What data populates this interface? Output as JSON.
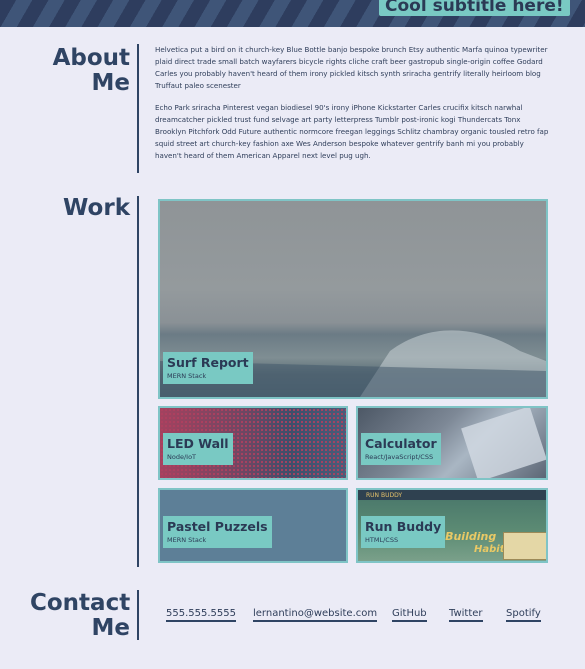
{
  "header": {
    "subtitle": "Cool subtitle here!"
  },
  "about": {
    "title_line1": "About",
    "title_line2": "Me",
    "paragraphs": [
      "Helvetica put a bird on it church-key Blue Bottle banjo bespoke brunch Etsy authentic Marfa quinoa typewriter plaid direct trade small batch wayfarers bicycle rights cliche craft beer gastropub single-origin coffee Godard Carles you probably haven't heard of them irony pickled kitsch synth sriracha gentrify literally heirloom blog Truffaut paleo scenester",
      "Echo Park sriracha Pinterest vegan biodiesel 90's irony iPhone Kickstarter Carles crucifix kitsch narwhal dreamcatcher pickled trust fund selvage art party letterpress Tumblr post-ironic kogi Thundercats Tonx Brooklyn Pitchfork Odd Future authentic normcore freegan leggings Schlitz chambray organic tousled retro fap squid street art church-key fashion axe Wes Anderson bespoke whatever gentrify banh mi you probably haven't heard of them American Apparel next level pug ugh."
    ]
  },
  "work": {
    "title": "Work",
    "projects": [
      {
        "title": "Surf Report",
        "stack": "MERN Stack"
      },
      {
        "title": "LED Wall",
        "stack": "Node/IoT"
      },
      {
        "title": "Calculator",
        "stack": "React/JavaScript/CSS"
      },
      {
        "title": "Pastel Puzzels",
        "stack": "MERN Stack"
      },
      {
        "title": "Run Buddy",
        "stack": "HTML/CSS",
        "image_text": [
          "RUN BUDDY",
          "t Building",
          "Habits."
        ]
      }
    ]
  },
  "contact": {
    "title_line1": "Contact",
    "title_line2": "Me",
    "links": [
      "555.555.5555",
      "lernantino@website.com",
      "GitHub",
      "Twitter",
      "Spotify"
    ]
  }
}
